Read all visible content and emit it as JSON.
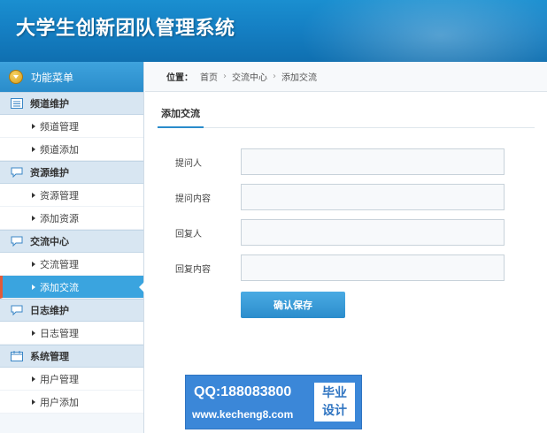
{
  "app": {
    "title": "大学生创新团队管理系统"
  },
  "sidebar": {
    "menu_title": "功能菜单",
    "groups": [
      {
        "title": "频道维护",
        "icon": "list-icon",
        "items": [
          {
            "label": "频道管理"
          },
          {
            "label": "频道添加"
          }
        ]
      },
      {
        "title": "资源维护",
        "icon": "chat-icon",
        "items": [
          {
            "label": "资源管理"
          },
          {
            "label": "添加资源"
          }
        ]
      },
      {
        "title": "交流中心",
        "icon": "chat-icon",
        "items": [
          {
            "label": "交流管理"
          },
          {
            "label": "添加交流"
          }
        ]
      },
      {
        "title": "日志维护",
        "icon": "chat-icon",
        "items": [
          {
            "label": "日志管理"
          }
        ]
      },
      {
        "title": "系统管理",
        "icon": "calendar-icon",
        "items": [
          {
            "label": "用户管理"
          },
          {
            "label": "用户添加"
          }
        ]
      }
    ],
    "active_item": "添加交流"
  },
  "breadcrumb": {
    "label": "位置：",
    "items": [
      "首页",
      "交流中心",
      "添加交流"
    ],
    "separator": "›"
  },
  "main": {
    "tab": "添加交流",
    "fields": [
      {
        "label": "提问人",
        "value": ""
      },
      {
        "label": "提问内容",
        "value": ""
      },
      {
        "label": "回复人",
        "value": ""
      },
      {
        "label": "回复内容",
        "value": ""
      }
    ],
    "save_label": "确认保存"
  },
  "watermark": {
    "qq": "QQ:188083800",
    "site": "www.kecheng8.com",
    "badge_line1": "毕业",
    "badge_line2": "设计"
  },
  "colors": {
    "header": "#1580c4",
    "accent": "#2a8ccb",
    "active_item": "#3aa4df",
    "active_marker": "#e05a3a"
  }
}
